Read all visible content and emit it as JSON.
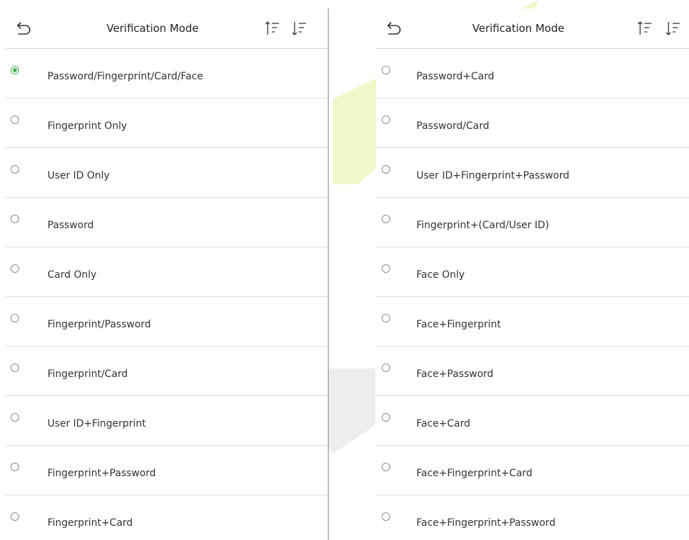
{
  "colors": {
    "accent": "#4caf50",
    "watermark_yellow": "#f1f7c9",
    "watermark_gray": "#ededed"
  },
  "left_panel": {
    "title": "Verification Mode",
    "icons": {
      "back": "back-arrow-icon",
      "sort_asc": "sort-ascending-icon",
      "sort_desc": "sort-descending-icon"
    },
    "options": [
      {
        "label": "Password/Fingerprint/Card/Face",
        "selected": true
      },
      {
        "label": "Fingerprint Only",
        "selected": false
      },
      {
        "label": "User ID Only",
        "selected": false
      },
      {
        "label": "Password",
        "selected": false
      },
      {
        "label": "Card Only",
        "selected": false
      },
      {
        "label": "Fingerprint/Password",
        "selected": false
      },
      {
        "label": "Fingerprint/Card",
        "selected": false
      },
      {
        "label": "User ID+Fingerprint",
        "selected": false
      },
      {
        "label": "Fingerprint+Password",
        "selected": false
      },
      {
        "label": "Fingerprint+Card",
        "selected": false
      }
    ]
  },
  "right_panel": {
    "title": "Verification Mode",
    "icons": {
      "back": "back-arrow-icon",
      "sort_asc": "sort-ascending-icon",
      "sort_desc": "sort-descending-icon"
    },
    "options": [
      {
        "label": "Password+Card",
        "selected": false
      },
      {
        "label": "Password/Card",
        "selected": false
      },
      {
        "label": "User ID+Fingerprint+Password",
        "selected": false
      },
      {
        "label": "Fingerprint+(Card/User ID)",
        "selected": false
      },
      {
        "label": "Face Only",
        "selected": false
      },
      {
        "label": "Face+Fingerprint",
        "selected": false
      },
      {
        "label": "Face+Password",
        "selected": false
      },
      {
        "label": "Face+Card",
        "selected": false
      },
      {
        "label": "Face+Fingerprint+Card",
        "selected": false
      },
      {
        "label": "Face+Fingerprint+Password",
        "selected": false
      }
    ]
  }
}
